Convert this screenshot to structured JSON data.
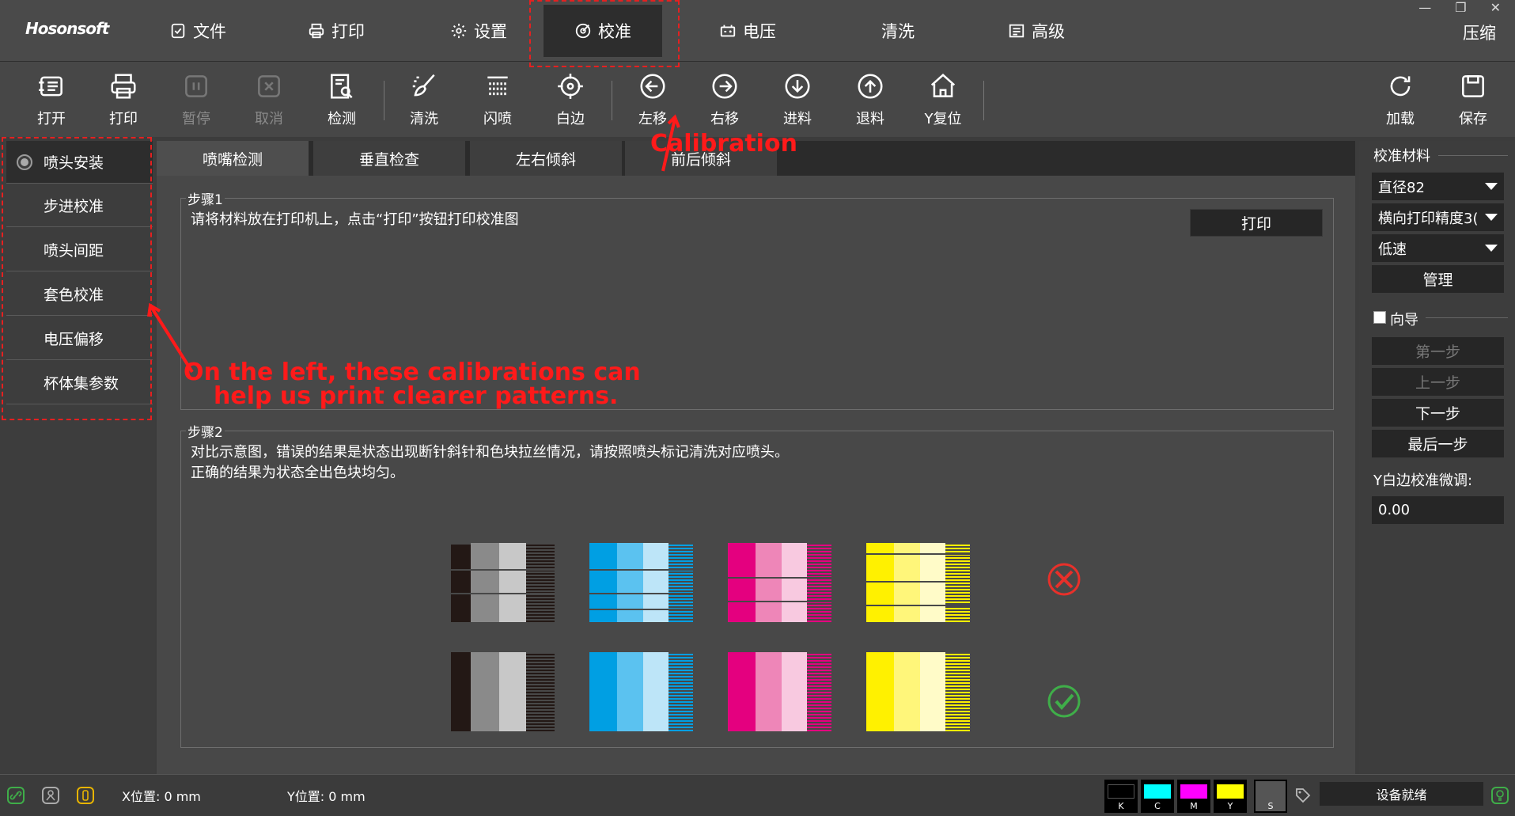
{
  "app": {
    "logo": "Hosonsoft",
    "window_controls": [
      "—",
      "❐",
      "✕"
    ],
    "compress_label": "压缩"
  },
  "menu_tabs": [
    {
      "label": "文件",
      "icon": "file-check-icon"
    },
    {
      "label": "打印",
      "icon": "printer-icon"
    },
    {
      "label": "设置",
      "icon": "gear-icon"
    },
    {
      "label": "校准",
      "icon": "calibration-target-icon",
      "active": true
    },
    {
      "label": "电压",
      "icon": "battery-icon"
    },
    {
      "label": "清洗",
      "icon": ""
    },
    {
      "label": "高级",
      "icon": "list-doc-icon"
    }
  ],
  "toolbar": {
    "open": "打开",
    "print": "打印",
    "pause": "暂停",
    "cancel": "取消",
    "detect": "检测",
    "clean": "清洗",
    "flash": "闪喷",
    "white_edge": "白边",
    "move_left": "左移",
    "move_right": "右移",
    "feed": "进料",
    "retract": "退料",
    "y_reset": "Y复位",
    "load": "加载",
    "save": "保存"
  },
  "sidebar": {
    "items": [
      {
        "label": "喷头安装",
        "active": true
      },
      {
        "label": "步进校准"
      },
      {
        "label": "喷头间距"
      },
      {
        "label": "套色校准"
      },
      {
        "label": "电压偏移"
      },
      {
        "label": "杯体集参数"
      }
    ]
  },
  "subtabs": [
    "喷嘴检测",
    "垂直检查",
    "左右倾斜",
    "前后倾斜"
  ],
  "step1": {
    "legend": "步骤1",
    "text": "请将材料放在打印机上，点击“打印”按钮打印校准图",
    "print_button": "打印"
  },
  "step2": {
    "legend": "步骤2",
    "line1": "对比示意图，错误的结果是状态出现断针斜针和色块拉丝情况，请按照喷头标记清洗对应喷头。",
    "line2": "正确的结果为状态全出色块均匀。"
  },
  "swatches": {
    "colors": [
      {
        "name": "black",
        "shades": [
          "#231815",
          "#8a8a8a",
          "#c8c8c8"
        ]
      },
      {
        "name": "cyan",
        "shades": [
          "#009fe3",
          "#5bc2f0",
          "#bde5f8"
        ]
      },
      {
        "name": "magenta",
        "shades": [
          "#e4007f",
          "#ee86b8",
          "#f8c9e0"
        ]
      },
      {
        "name": "yellow",
        "shades": [
          "#fff100",
          "#fff67a",
          "#fffbc8"
        ]
      }
    ]
  },
  "right_panel": {
    "material_title": "校准材料",
    "material_select": "直径82",
    "precision_select": "横向打印精度3(",
    "speed_select": "低速",
    "manage_button": "管理",
    "wizard_label": "向导",
    "first_step": "第一步",
    "prev_step": "上一步",
    "next_step": "下一步",
    "last_step": "最后一步",
    "y_fine_tune_label": "Y白边校准微调:",
    "y_fine_tune_value": "0.00"
  },
  "statusbar": {
    "x_pos": "X位置: 0 mm",
    "y_pos": "Y位置: 0 mm",
    "inks": [
      {
        "label": "K",
        "color": "#000000"
      },
      {
        "label": "C",
        "color": "#00ffff"
      },
      {
        "label": "M",
        "color": "#ff00ff"
      },
      {
        "label": "Y",
        "color": "#ffff00"
      },
      {
        "label": "S",
        "color": "#d0d0d0"
      }
    ],
    "device_status": "设备就绪"
  },
  "annotations": {
    "calibration": "Calibration",
    "left_note_line1": "On the left, these calibrations can",
    "left_note_line2": "help us print clearer patterns."
  },
  "colors": {
    "accent_red": "#ff1a1a",
    "ok_green": "#3fae49",
    "error_red": "#e8302a"
  }
}
